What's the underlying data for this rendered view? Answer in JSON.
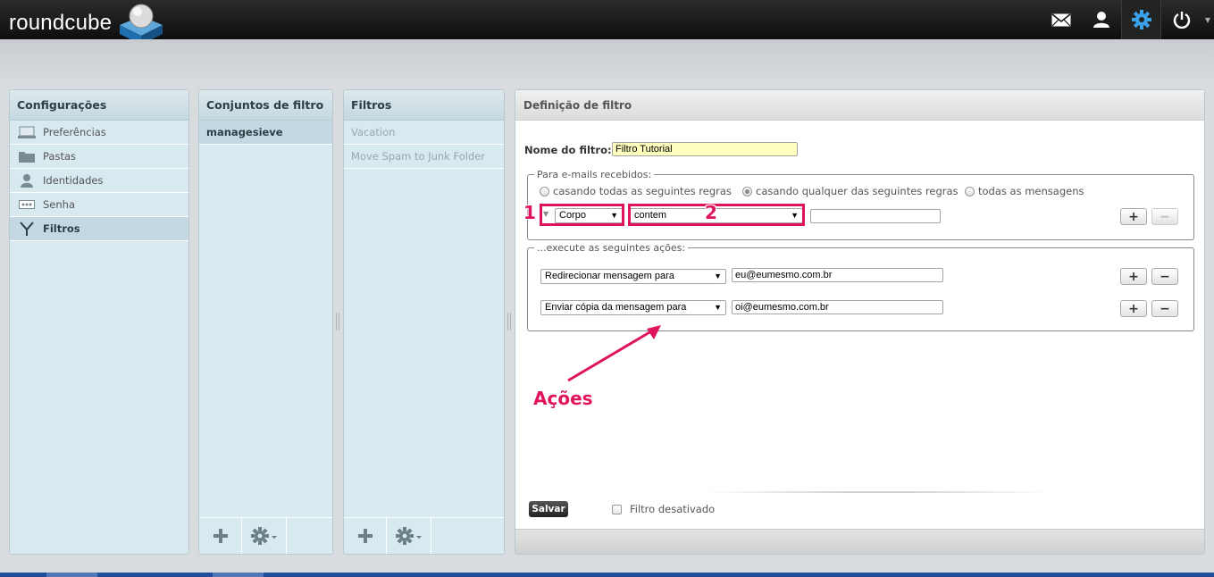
{
  "app": {
    "logo_text": "roundcube",
    "nav": [
      {
        "name": "mail-icon",
        "label": "mail"
      },
      {
        "name": "contacts-icon",
        "label": "contacts"
      },
      {
        "name": "settings-icon",
        "label": "settings"
      },
      {
        "name": "logout-icon",
        "label": "logout"
      }
    ]
  },
  "settings": {
    "title": "Configurações",
    "items": [
      {
        "label": "Preferências",
        "icon": "monitor-icon"
      },
      {
        "label": "Pastas",
        "icon": "folder-icon"
      },
      {
        "label": "Identidades",
        "icon": "identity-icon"
      },
      {
        "label": "Senha",
        "icon": "password-icon"
      },
      {
        "label": "Filtros",
        "icon": "filter-icon",
        "selected": true
      }
    ]
  },
  "filter_sets": {
    "title": "Conjuntos de filtro",
    "items": [
      {
        "label": "managesieve",
        "selected": true
      }
    ]
  },
  "filters": {
    "title": "Filtros",
    "items": [
      {
        "label": "Vacation"
      },
      {
        "label": "Move Spam to Junk Folder"
      }
    ]
  },
  "definition": {
    "title": "Definição de filtro",
    "name_label": "Nome do filtro:",
    "name_value": "Filtro Tutorial",
    "rules_legend": "Para e-mails recebidos:",
    "radio_all": "casando todas as seguintes regras",
    "radio_any": "casando qualquer das seguintes regras",
    "radio_every": "todas as mensagens",
    "rule": {
      "header": "Corpo",
      "operator": "contem",
      "value": ""
    },
    "actions_legend": "...execute as seguintes ações:",
    "actions": [
      {
        "type": "Redirecionar mensagem para",
        "value": "eu@eumesmo.com.br"
      },
      {
        "type": "Enviar cópia da mensagem para",
        "value": "oi@eumesmo.com.br"
      }
    ],
    "plus": "+",
    "minus": "−",
    "save_label": "Salvar",
    "disabled_label": "Filtro desativado"
  },
  "annotations": {
    "one": "1",
    "two": "2",
    "actions": "Ações",
    "color": "#e0145e"
  }
}
